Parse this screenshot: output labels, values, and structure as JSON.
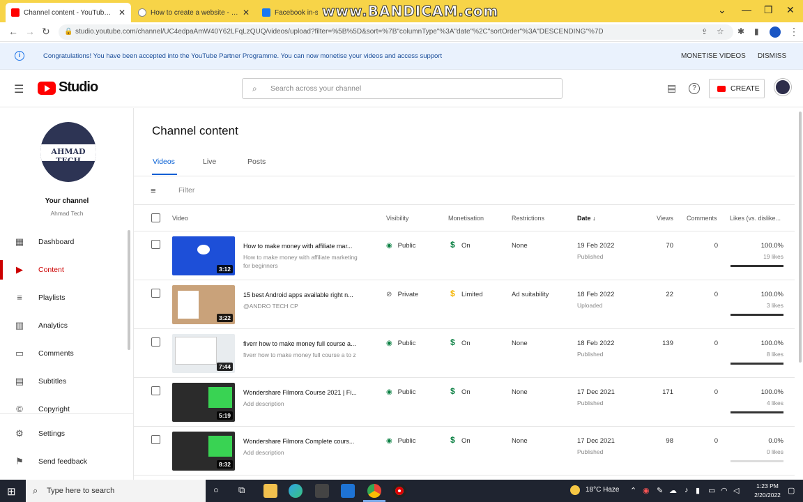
{
  "browser": {
    "tabs": [
      {
        "title": "Channel content - YouTube Studio",
        "active": true
      },
      {
        "title": "How to create a website - Google",
        "active": false
      },
      {
        "title": "Facebook in-stream",
        "active": false
      }
    ],
    "watermark": "www.BANDICAM.com",
    "url": "studio.youtube.com/channel/UC4edpaAmW40Y62LFqLzQUQ/videos/upload?filter=%5B%5D&sort=%7B\"columnType\"%3A\"date\"%2C\"sortOrder\"%3A\"DESCENDING\"%7D"
  },
  "banner": {
    "message": "Congratulations! You have been accepted into the YouTube Partner Programme. You can now monetise your videos and access support",
    "monetise_label": "MONETISE VIDEOS",
    "dismiss_label": "DISMISS"
  },
  "header": {
    "logo_text": "Studio",
    "search_placeholder": "Search across your channel",
    "create_label": "CREATE"
  },
  "sidebar": {
    "avatar_text": "AHMAD TECH",
    "channel_title": "Your channel",
    "channel_name": "Ahmad Tech",
    "items": [
      {
        "label": "Dashboard",
        "icon": "dashboard-icon"
      },
      {
        "label": "Content",
        "icon": "content-icon",
        "active": true
      },
      {
        "label": "Playlists",
        "icon": "playlists-icon"
      },
      {
        "label": "Analytics",
        "icon": "analytics-icon"
      },
      {
        "label": "Comments",
        "icon": "comments-icon"
      },
      {
        "label": "Subtitles",
        "icon": "subtitles-icon"
      },
      {
        "label": "Copyright",
        "icon": "copyright-icon"
      },
      {
        "label": "Settings",
        "icon": "gear-icon"
      },
      {
        "label": "Send feedback",
        "icon": "feedback-icon"
      }
    ]
  },
  "main": {
    "title": "Channel content",
    "tabs": [
      "Videos",
      "Live",
      "Posts"
    ],
    "filter_placeholder": "Filter",
    "columns": [
      "Video",
      "Visibility",
      "Monetisation",
      "Restrictions",
      "Date",
      "Views",
      "Comments",
      "Likes (vs. dislike..."
    ],
    "rows": [
      {
        "title": "How to make money with affiliate mar...",
        "desc": "How to make money with affiliate marketing for beginners",
        "duration": "3:12",
        "visibility": "Public",
        "monetisation": "On",
        "restrictions": "None",
        "date": "19 Feb 2022",
        "status": "Published",
        "views": "70",
        "comments": "0",
        "likes_pct": "100.0%",
        "likes_count": "19 likes",
        "likes_fraction": 1.0,
        "thumb_color": "#1d4fd8"
      },
      {
        "title": "15 best Android apps available right n...",
        "desc": "@ANDRO TECH CP",
        "duration": "3:22",
        "visibility": "Private",
        "monetisation": "Limited",
        "restrictions": "Ad suitability",
        "date": "18 Feb 2022",
        "status": "Uploaded",
        "views": "22",
        "comments": "0",
        "likes_pct": "100.0%",
        "likes_count": "3 likes",
        "likes_fraction": 1.0,
        "thumb_color": "#c9a27a"
      },
      {
        "title": "fiverr how to make money full course a...",
        "desc": "fiverr how to make money full course a to z",
        "duration": "7:44",
        "visibility": "Public",
        "monetisation": "On",
        "restrictions": "None",
        "date": "18 Feb 2022",
        "status": "Published",
        "views": "139",
        "comments": "0",
        "likes_pct": "100.0%",
        "likes_count": "8 likes",
        "likes_fraction": 1.0,
        "thumb_color": "#e8ecef"
      },
      {
        "title": "Wondershare Filmora Course 2021 | Fi...",
        "desc": "Add description",
        "duration": "5:19",
        "visibility": "Public",
        "monetisation": "On",
        "restrictions": "None",
        "date": "17 Dec 2021",
        "status": "Published",
        "views": "171",
        "comments": "0",
        "likes_pct": "100.0%",
        "likes_count": "4 likes",
        "likes_fraction": 1.0,
        "thumb_color": "#2b2b2b"
      },
      {
        "title": "Wondershare Filmora Complete cours...",
        "desc": "Add description",
        "duration": "8:32",
        "visibility": "Public",
        "monetisation": "On",
        "restrictions": "None",
        "date": "17 Dec 2021",
        "status": "Published",
        "views": "98",
        "comments": "0",
        "likes_pct": "0.0%",
        "likes_count": "0 likes",
        "likes_fraction": 0.0,
        "thumb_color": "#2b2b2b"
      }
    ]
  },
  "taskbar": {
    "search_placeholder": "Type here to search",
    "weather": "18°C  Haze",
    "time": "1:23 PM",
    "date": "2/20/2022"
  }
}
